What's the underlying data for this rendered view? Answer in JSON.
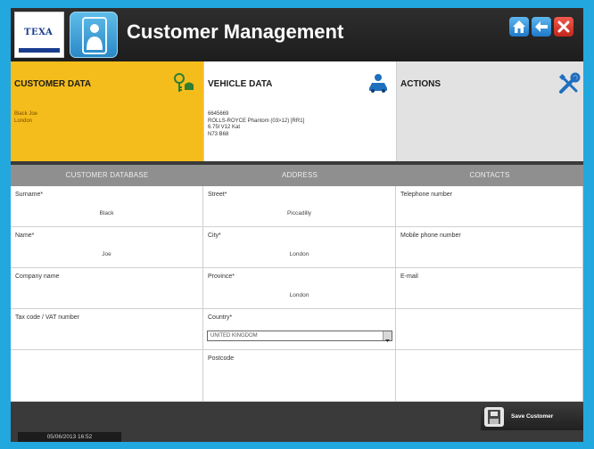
{
  "header": {
    "logo_text": "TEXA",
    "title": "Customer Management",
    "icons": {
      "module": "customer-person-icon",
      "home": "home-icon",
      "back": "back-arrow-icon",
      "close": "close-icon"
    }
  },
  "tabs": {
    "customer": {
      "title": "CUSTOMER DATA",
      "lines": [
        "Black Joe",
        "London"
      ],
      "icon": "keys-icon",
      "color": "#f5bd1b"
    },
    "vehicle": {
      "title": "VEHICLE DATA",
      "lines": [
        "6645669",
        "ROLLS-ROYCE Phantom (03>12) [RR1]",
        "6.75l V12 Kat",
        "N73 B68"
      ],
      "icon": "driver-car-icon"
    },
    "actions": {
      "title": "ACTIONS",
      "icon": "wrench-screwdriver-icon"
    }
  },
  "table": {
    "headers": [
      "CUSTOMER DATABASE",
      "ADDRESS",
      "CONTACTS"
    ],
    "customer_fields": [
      {
        "label": "Surname*",
        "value": "Black"
      },
      {
        "label": "Name*",
        "value": "Joe"
      },
      {
        "label": "Company name",
        "value": ""
      },
      {
        "label": "Tax code / VAT number",
        "value": ""
      }
    ],
    "address_fields": [
      {
        "label": "Street*",
        "value": "Piccadilly"
      },
      {
        "label": "City*",
        "value": "London"
      },
      {
        "label": "Province*",
        "value": "London"
      },
      {
        "label": "Country*",
        "value": "UNITED KINGDOM"
      },
      {
        "label": "Postcode",
        "value": ""
      }
    ],
    "contact_fields": [
      {
        "label": "Telephone number",
        "value": ""
      },
      {
        "label": "Mobile phone number",
        "value": ""
      },
      {
        "label": "E-mail",
        "value": ""
      }
    ]
  },
  "footer": {
    "save_label": "Save Customer",
    "save_icon": "save-customer-icon",
    "date": "05/06/2013 16:52"
  },
  "colors": {
    "accent_blue": "#23a7df",
    "customer_tab": "#f5bd1b",
    "close_red": "#d9342a"
  }
}
